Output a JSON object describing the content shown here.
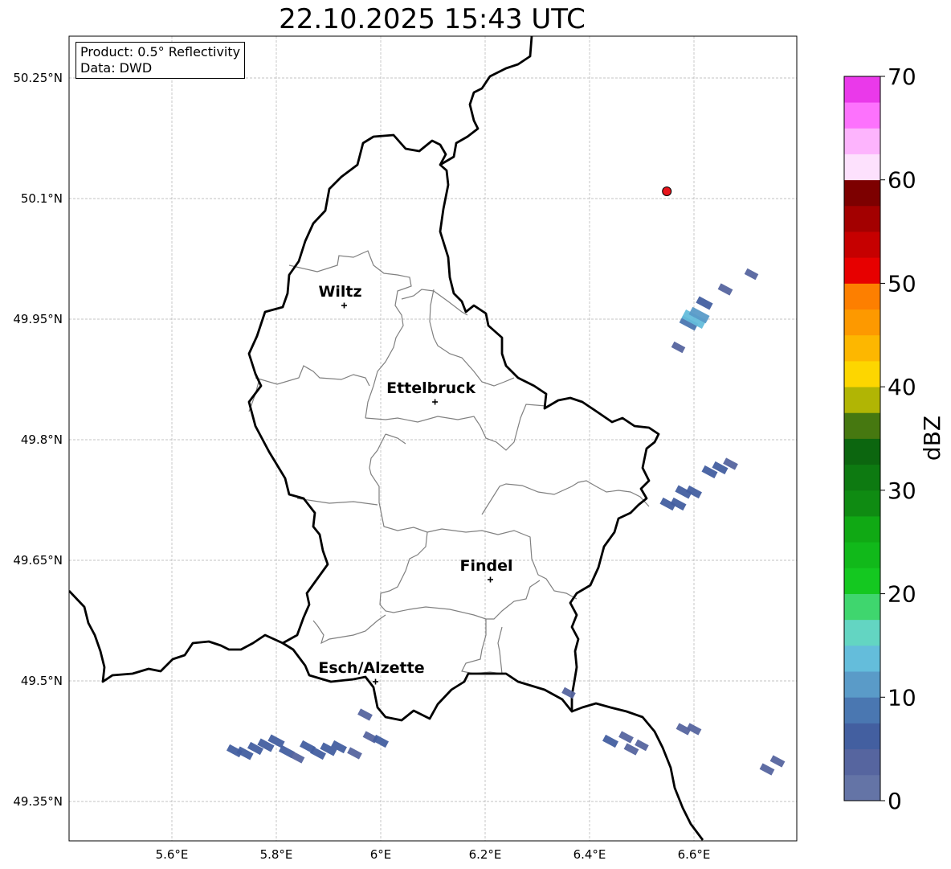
{
  "title": "22.10.2025 15:43 UTC",
  "info": {
    "product": "Product: 0.5° Reflectivity",
    "data_source": "Data: DWD"
  },
  "map": {
    "lon_range": [
      5.4,
      6.8
    ],
    "lat_range": [
      49.3,
      50.3
    ],
    "lon_ticks": [
      {
        "value": 5.6,
        "label": "5.6°E"
      },
      {
        "value": 5.8,
        "label": "5.8°E"
      },
      {
        "value": 6.0,
        "label": "6°E"
      },
      {
        "value": 6.2,
        "label": "6.2°E"
      },
      {
        "value": 6.4,
        "label": "6.4°E"
      },
      {
        "value": 6.6,
        "label": "6.6°E"
      }
    ],
    "lat_ticks": [
      {
        "value": 50.25,
        "label": "50.25°N"
      },
      {
        "value": 50.1,
        "label": "50.1°N"
      },
      {
        "value": 49.95,
        "label": "49.95°N"
      },
      {
        "value": 49.8,
        "label": "49.8°N"
      },
      {
        "value": 49.65,
        "label": "49.65°N"
      },
      {
        "value": 49.5,
        "label": "49.5°N"
      },
      {
        "value": 49.35,
        "label": "49.35°N"
      }
    ],
    "gridlines": true,
    "cities": [
      {
        "name": "Wiltz",
        "lon": 5.93,
        "lat": 49.967
      },
      {
        "name": "Ettelbruck",
        "lon": 6.104,
        "lat": 49.847
      },
      {
        "name": "Findel",
        "lon": 6.21,
        "lat": 49.626
      },
      {
        "name": "Esch/Alzette",
        "lon": 5.99,
        "lat": 49.499
      }
    ],
    "radar_site": {
      "lon": 6.548,
      "lat": 50.109,
      "color": "#e8141b"
    }
  },
  "colorbar": {
    "label": "dBZ",
    "min": 0,
    "max": 70,
    "tick_labels": [
      "0",
      "10",
      "20",
      "30",
      "40",
      "50",
      "60",
      "70"
    ],
    "colors": [
      "#6474a6",
      "#56659f",
      "#435fa0",
      "#4a77b1",
      "#5a9bc8",
      "#64bddb",
      "#63d5c2",
      "#3fd66e",
      "#14c820",
      "#11b91a",
      "#10a914",
      "#0f8b12",
      "#0d7a11",
      "#0c660f",
      "#467810",
      "#b1b504",
      "#fdd600",
      "#fdb700",
      "#fd9900",
      "#fd7f00",
      "#e70000",
      "#c60000",
      "#a30000",
      "#7d0000",
      "#fde1fd",
      "#fdb4fd",
      "#fd72fd",
      "#ea39ea"
    ]
  },
  "echoes": [
    {
      "lon": 5.72,
      "lat": 49.413,
      "dbz": 5
    },
    {
      "lon": 5.74,
      "lat": 49.41,
      "dbz": 6
    },
    {
      "lon": 5.76,
      "lat": 49.416,
      "dbz": 5
    },
    {
      "lon": 5.78,
      "lat": 49.42,
      "dbz": 6
    },
    {
      "lon": 5.8,
      "lat": 49.425,
      "dbz": 6
    },
    {
      "lon": 5.82,
      "lat": 49.412,
      "dbz": 5
    },
    {
      "lon": 5.84,
      "lat": 49.405,
      "dbz": 4
    },
    {
      "lon": 5.86,
      "lat": 49.418,
      "dbz": 5
    },
    {
      "lon": 5.88,
      "lat": 49.41,
      "dbz": 5
    },
    {
      "lon": 5.9,
      "lat": 49.415,
      "dbz": 6
    },
    {
      "lon": 5.92,
      "lat": 49.418,
      "dbz": 5
    },
    {
      "lon": 5.95,
      "lat": 49.41,
      "dbz": 4
    },
    {
      "lon": 5.98,
      "lat": 49.43,
      "dbz": 4
    },
    {
      "lon": 6.0,
      "lat": 49.425,
      "dbz": 5
    },
    {
      "lon": 5.97,
      "lat": 49.458,
      "dbz": 4
    },
    {
      "lon": 6.36,
      "lat": 49.485,
      "dbz": 3
    },
    {
      "lon": 6.44,
      "lat": 49.425,
      "dbz": 5
    },
    {
      "lon": 6.47,
      "lat": 49.43,
      "dbz": 4
    },
    {
      "lon": 6.48,
      "lat": 49.415,
      "dbz": 4
    },
    {
      "lon": 6.5,
      "lat": 49.42,
      "dbz": 3
    },
    {
      "lon": 6.58,
      "lat": 49.44,
      "dbz": 4
    },
    {
      "lon": 6.6,
      "lat": 49.44,
      "dbz": 4
    },
    {
      "lon": 6.74,
      "lat": 49.39,
      "dbz": 4
    },
    {
      "lon": 6.76,
      "lat": 49.4,
      "dbz": 4
    },
    {
      "lon": 6.55,
      "lat": 49.72,
      "dbz": 5
    },
    {
      "lon": 6.57,
      "lat": 49.72,
      "dbz": 5
    },
    {
      "lon": 6.58,
      "lat": 49.735,
      "dbz": 6
    },
    {
      "lon": 6.6,
      "lat": 49.735,
      "dbz": 5
    },
    {
      "lon": 6.63,
      "lat": 49.76,
      "dbz": 5
    },
    {
      "lon": 6.65,
      "lat": 49.765,
      "dbz": 5
    },
    {
      "lon": 6.67,
      "lat": 49.77,
      "dbz": 4
    },
    {
      "lon": 6.59,
      "lat": 49.945,
      "dbz": 8
    },
    {
      "lon": 6.6,
      "lat": 49.95,
      "dbz": 14
    },
    {
      "lon": 6.61,
      "lat": 49.955,
      "dbz": 10
    },
    {
      "lon": 6.62,
      "lat": 49.97,
      "dbz": 6
    },
    {
      "lon": 6.66,
      "lat": 49.987,
      "dbz": 4
    },
    {
      "lon": 6.71,
      "lat": 50.006,
      "dbz": 3
    },
    {
      "lon": 6.57,
      "lat": 49.915,
      "dbz": 3
    }
  ]
}
